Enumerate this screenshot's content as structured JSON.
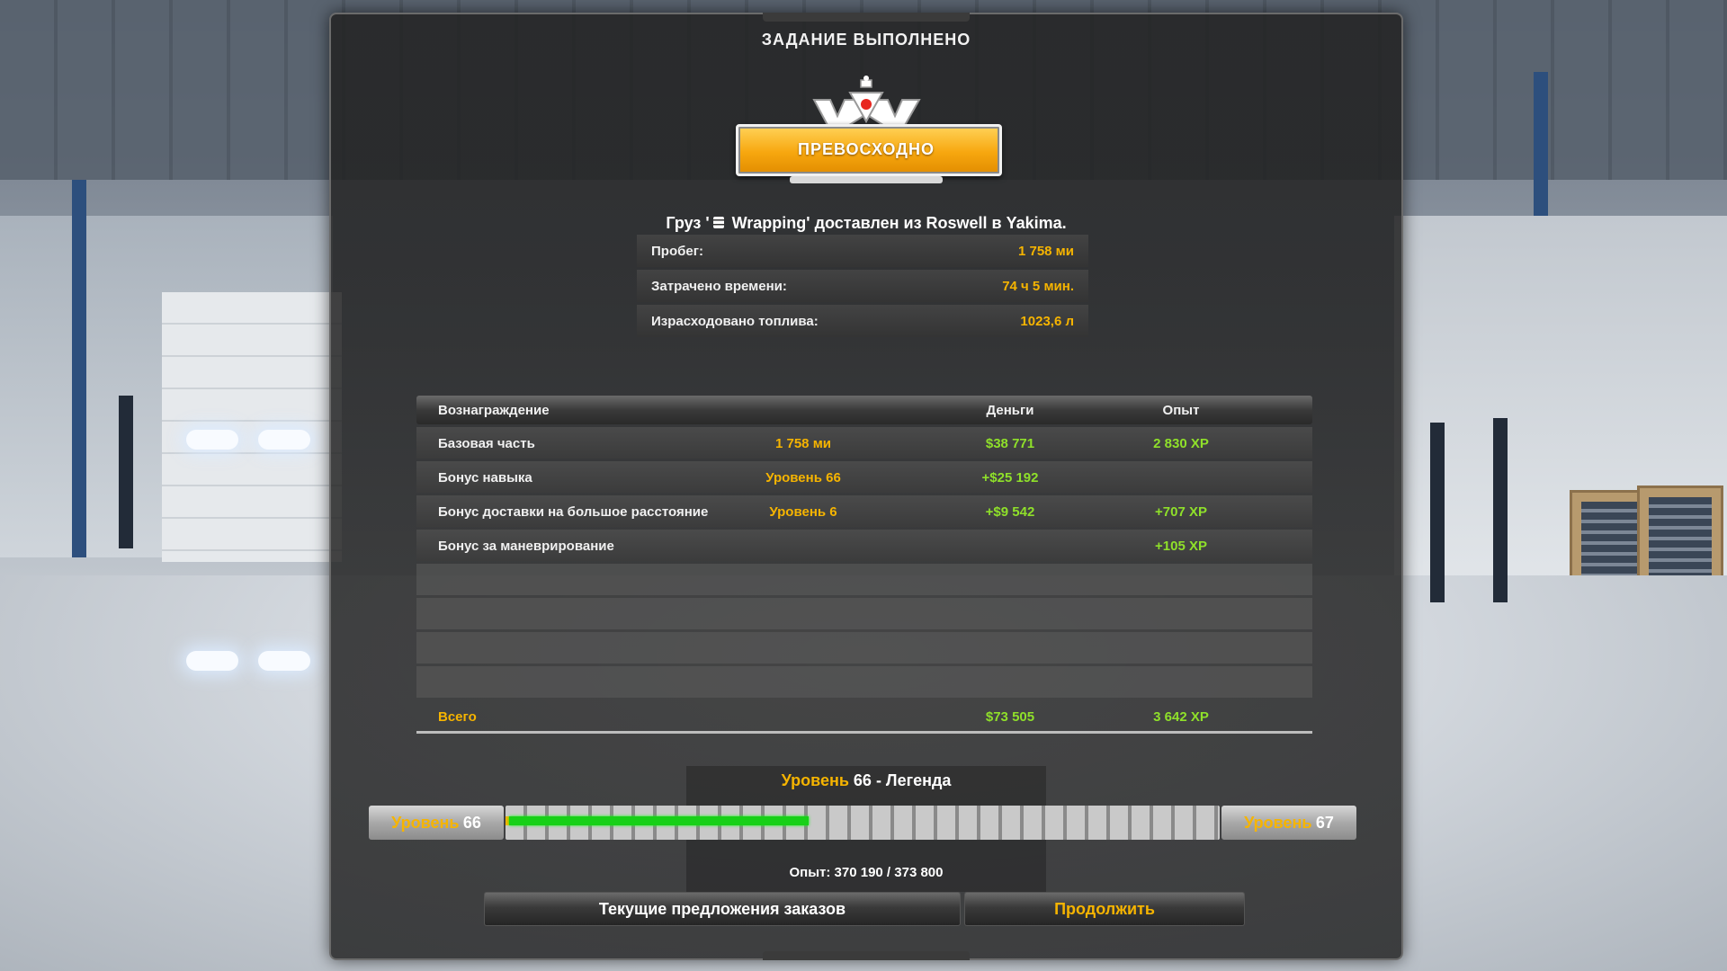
{
  "dialog": {
    "title": "ЗАДАНИЕ ВЫПОЛНЕНО"
  },
  "badge": {
    "label": "ПРЕВОСХОДНО"
  },
  "cargo": {
    "prefix": "Груз '",
    "text": " Wrapping' доставлен из Roswell в Yakima."
  },
  "stats": [
    {
      "label": "Пробег:",
      "value": "1 758 ми"
    },
    {
      "label": "Затрачено времени:",
      "value": "74 ч 5 мин."
    },
    {
      "label": "Израсходовано топлива:",
      "value": "1023,6 л"
    }
  ],
  "rewards": {
    "headers": {
      "reward": "Вознаграждение",
      "money": "Деньги",
      "xp": "Опыт"
    },
    "rows": [
      {
        "name": "Базовая часть",
        "detail": "1 758 ми",
        "money": "$38 771",
        "xp": "2 830 XP"
      },
      {
        "name": "Бонус навыка",
        "detail": "Уровень 66",
        "money": "+$25 192",
        "xp": ""
      },
      {
        "name": "Бонус доставки на большое расстояние",
        "detail": "Уровень 6",
        "money": "+$9 542",
        "xp": "+707 XP"
      },
      {
        "name": "Бонус за маневрирование",
        "detail": "",
        "money": "",
        "xp": "+105 XP"
      }
    ],
    "total": {
      "label": "Всего",
      "money": "$73 505",
      "xp": "3 642 XP"
    }
  },
  "level": {
    "word": "Уровень",
    "current": "66",
    "rank": " - Легенда",
    "next": "67",
    "progress": 0.424
  },
  "experience": {
    "text": "Опыт: 370 190 / 373 800"
  },
  "buttons": {
    "offers": "Текущие предложения заказов",
    "continue": "Продолжить"
  },
  "colors": {
    "accent": "#f6b400",
    "positive": "#8fe02a",
    "progress": "#18d018"
  }
}
